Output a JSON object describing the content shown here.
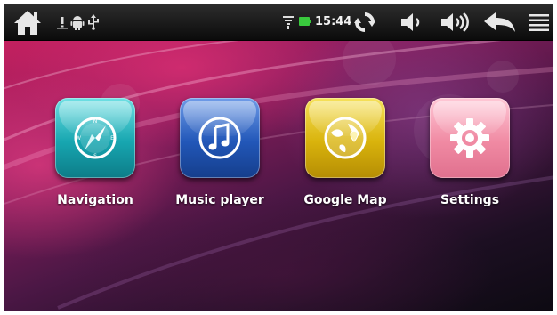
{
  "status_bar": {
    "clock": "15:44",
    "icons": {
      "home": "home-icon",
      "warning": "warning-icon",
      "android": "android-debug-icon",
      "usb": "usb-icon",
      "wifi": "wifi-icon",
      "battery": "battery-icon",
      "refresh": "refresh-icon",
      "volume_down": "volume-down-icon",
      "volume_up": "volume-up-icon",
      "back": "back-icon",
      "menu": "menu-icon"
    },
    "battery_color": "#39c93d"
  },
  "apps": [
    {
      "label": "Navigation",
      "icon": "compass-icon",
      "color": "#17a6b0"
    },
    {
      "label": "Music player",
      "icon": "music-note-icon",
      "color": "#2257b8"
    },
    {
      "label": "Google Map",
      "icon": "globe-pin-icon",
      "color": "#d9b30c"
    },
    {
      "label": "Settings",
      "icon": "gear-icon",
      "color": "#f08aa3"
    }
  ]
}
